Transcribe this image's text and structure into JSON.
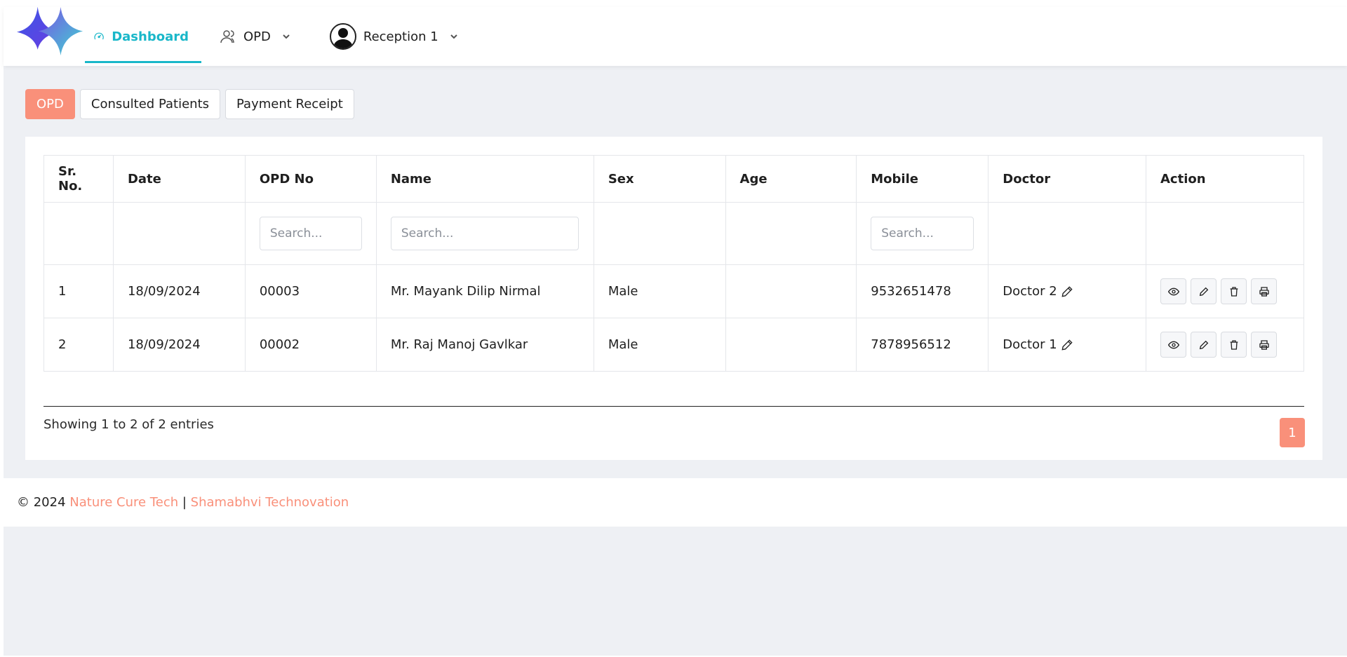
{
  "header": {
    "nav": {
      "dashboard_label": "Dashboard",
      "opd_label": "OPD",
      "user_label": "Reception 1"
    },
    "accent_color": "#19b7c9"
  },
  "tabs": [
    {
      "label": "OPD",
      "active": true
    },
    {
      "label": "Consulted Patients",
      "active": false
    },
    {
      "label": "Payment Receipt",
      "active": false
    }
  ],
  "table": {
    "columns": [
      "Sr. No.",
      "Date",
      "OPD No",
      "Name",
      "Sex",
      "Age",
      "Mobile",
      "Doctor",
      "Action"
    ],
    "search_placeholder": "Search...",
    "rows": [
      {
        "sr": "1",
        "date": "18/09/2024",
        "opd_no": "00003",
        "name": "Mr. Mayank Dilip Nirmal",
        "sex": "Male",
        "age": "",
        "mobile": "9532651478",
        "doctor": "Doctor 2"
      },
      {
        "sr": "2",
        "date": "18/09/2024",
        "opd_no": "00002",
        "name": "Mr. Raj Manoj Gavlkar",
        "sex": "Male",
        "age": "",
        "mobile": "7878956512",
        "doctor": "Doctor 1"
      }
    ]
  },
  "pagination": {
    "summary": "Showing 1 to 2 of 2 entries",
    "current_page": "1"
  },
  "footer": {
    "copyright": "© 2024",
    "company_1": "Nature Cure Tech",
    "separator": "|",
    "company_2": "Shamabhvi Technovation"
  },
  "colors": {
    "primary": "#f9907a",
    "background": "#eef0f4"
  }
}
